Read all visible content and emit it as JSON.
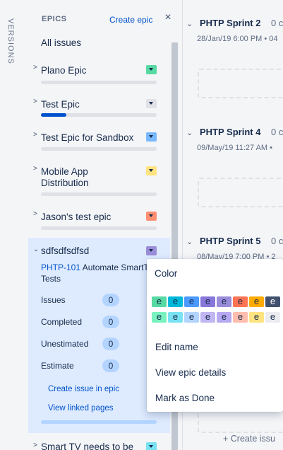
{
  "versions_label": "VERSIONS",
  "epics_panel": {
    "title": "EPICS",
    "create_epic": "Create epic",
    "close_glyph": "×",
    "all_issues": "All issues",
    "epics": [
      {
        "name": "Plano Epic",
        "color": "#57d9a3",
        "progress": 0
      },
      {
        "name": "Test Epic",
        "color": "#dfe1e6",
        "progress": 0.22
      },
      {
        "name": "Test Epic for Sandbox",
        "color": "#79b8ff",
        "progress": 0
      },
      {
        "name": "Mobile App Distribution",
        "color": "#ffe380",
        "progress": 0
      },
      {
        "name": "Jason's test epic",
        "color": "#ff8f73",
        "progress": 0
      }
    ],
    "expanded_epic": {
      "name": "sdfsdfsdfsd",
      "color": "#998dd9",
      "issue_key": "PHTP-101",
      "issue_title": "Automate SmartT Tests",
      "stats": [
        {
          "label": "Issues",
          "value": "0"
        },
        {
          "label": "Completed",
          "value": "0"
        },
        {
          "label": "Unestimated",
          "value": "0"
        },
        {
          "label": "Estimate",
          "value": "0"
        }
      ],
      "create_issue_link": "Create issue in epic",
      "view_linked_link": "View linked pages"
    },
    "next_epic": {
      "name": "Smart TV needs to be",
      "color": "#79e2f2"
    }
  },
  "sprints": [
    {
      "name": "PHTP Sprint 2",
      "count": "0 c",
      "date": "28/Jan/19 6:00 PM • 04"
    },
    {
      "name": "PHTP Sprint 4",
      "count": "0 c",
      "date": "09/May/19 11:27 AM •"
    },
    {
      "name": "PHTP Sprint 5",
      "count": "0 c",
      "date": "08/May/19 7:00 PM • 2"
    }
  ],
  "create_issue": "+ Create issu",
  "color_menu": {
    "title": "Color",
    "swatch_letter": "e",
    "row1_colors": [
      "#57d9a3",
      "#00b8d9",
      "#4c9aff",
      "#8777d9",
      "#998dd9",
      "#ff7452",
      "#ffab00",
      "#42526e"
    ],
    "row2_colors": [
      "#79f2c0",
      "#79e2f2",
      "#b3d4ff",
      "#c0b6f2",
      "#b6a9f2",
      "#ffbdad",
      "#ffe380",
      "#ebecf0"
    ],
    "items": [
      "Edit name",
      "View epic details",
      "Mark as Done"
    ]
  }
}
